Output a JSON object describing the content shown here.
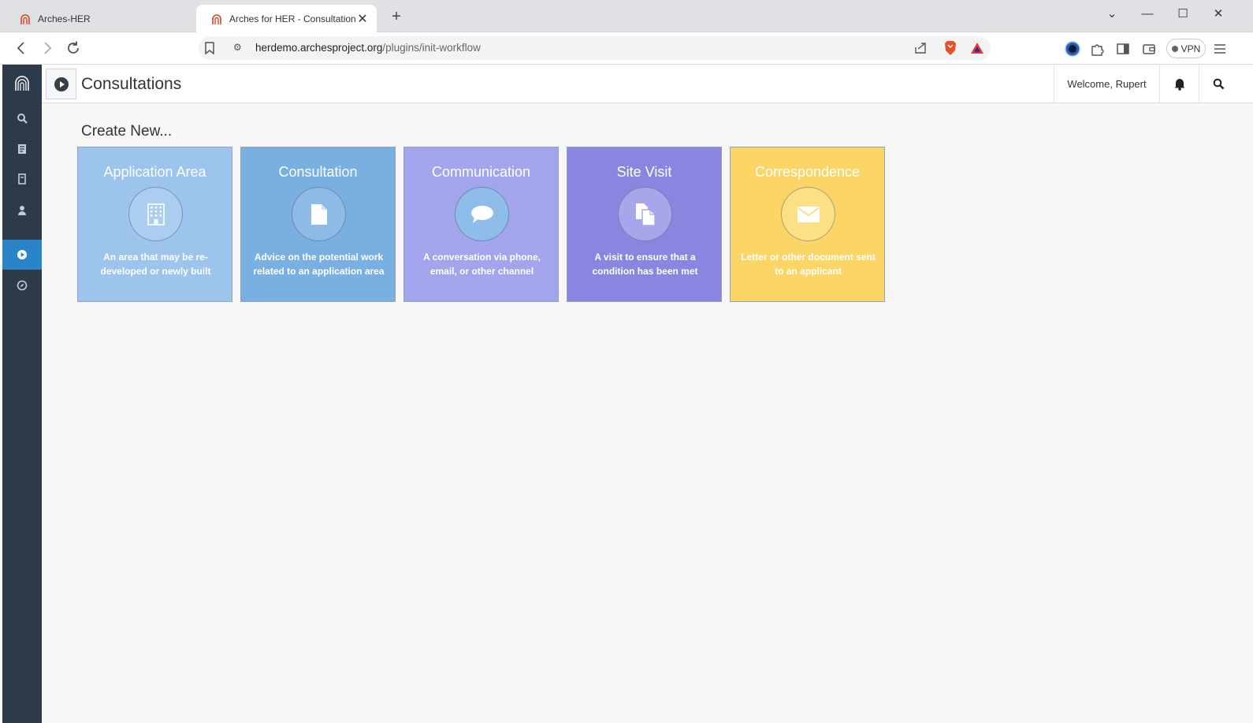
{
  "browser": {
    "tabs": [
      {
        "title": "Arches-HER",
        "active": false
      },
      {
        "title": "Arches for HER - Consultations",
        "active": true
      }
    ],
    "url": {
      "host": "herdemo.archesproject.org",
      "path": "/plugins/init-workflow"
    },
    "vpn_label": "VPN"
  },
  "app": {
    "page_title": "Consultations",
    "welcome": "Welcome, Rupert",
    "create_new_label": "Create New...",
    "sidebar": [
      "search-icon",
      "resource-icon",
      "bookmark-icon",
      "user-icon",
      "play-icon",
      "compass-icon"
    ],
    "cards": [
      {
        "title": "Application Area",
        "description": "An area that may be re-developed or newly built",
        "color": "#9cc4ec",
        "circle_color": "#abcdef",
        "icon": "building-icon"
      },
      {
        "title": "Consultation",
        "description": "Advice on the potential work related to an application area",
        "color": "#7ab0e1",
        "circle_color": "#8ebbe6",
        "icon": "file-icon"
      },
      {
        "title": "Communication",
        "description": "A conversation via phone, email, or other channel",
        "color": "#a3a4ec",
        "circle_color": "#8fbde9",
        "icon": "speech-bubble-icon"
      },
      {
        "title": "Site Visit",
        "description": "A visit to ensure that a condition has been met",
        "color": "#8a86e0",
        "circle_color": "#a8a6eb",
        "icon": "copy-icon"
      },
      {
        "title": "Correspondence",
        "description": "Letter or other document sent to an applicant",
        "color": "#fbd667",
        "circle_color": "#fde085",
        "icon": "envelope-icon"
      }
    ]
  }
}
